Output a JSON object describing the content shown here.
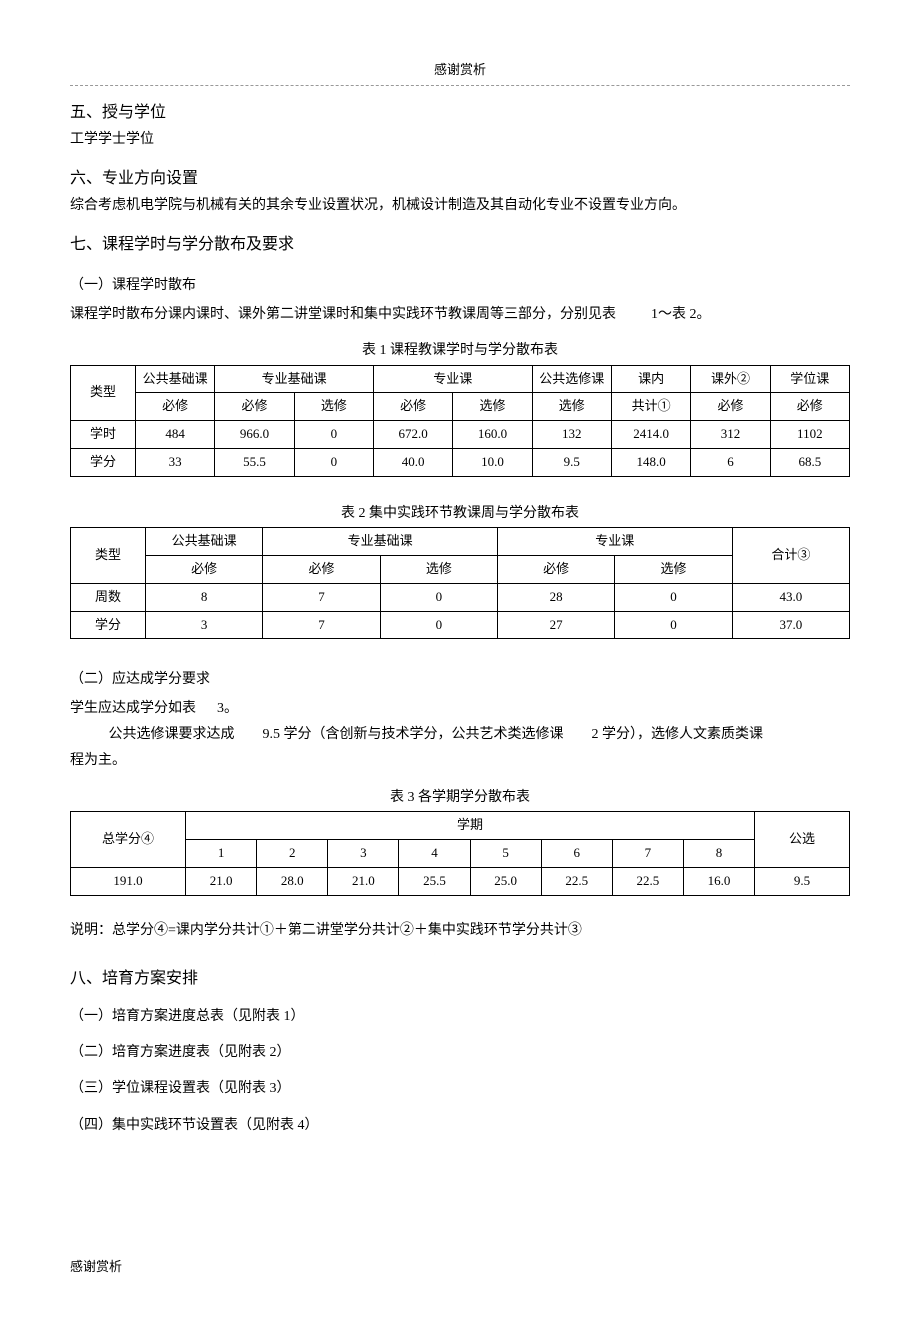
{
  "header": {
    "note_top": "感谢赏析",
    "note_bottom": "感谢赏析"
  },
  "s5": {
    "title": "五、授与学位",
    "body": "工学学士学位"
  },
  "s6": {
    "title": "六、专业方向设置",
    "body": "综合考虑机电学院与机械有关的其余专业设置状况，机械设计制造及其自动化专业不设置专业方向。"
  },
  "s7": {
    "title": "七、课程学时与学分散布及要求",
    "p1": {
      "heading": "（一）课程学时散布",
      "line_a": "课程学时散布分课内课时、课外第二讲堂课时和集中实践环节教课周等三部分，分别见表",
      "line_b": "1～表 2。"
    },
    "t1": {
      "caption": "表 1 课程教课学时与学分散布表",
      "type_label": "类型",
      "h1": [
        "公共基础课",
        "专业基础课",
        "专业课",
        "公共选修课",
        "课内",
        "课外②",
        "学位课"
      ],
      "h2": [
        "必修",
        "必修",
        "选修",
        "必修",
        "选修",
        "选修",
        "共计①",
        "必修",
        "必修"
      ],
      "rows": [
        {
          "label": "学时",
          "cells": [
            "484",
            "966.0",
            "0",
            "672.0",
            "160.0",
            "132",
            "2414.0",
            "312",
            "1102"
          ]
        },
        {
          "label": "学分",
          "cells": [
            "33",
            "55.5",
            "0",
            "40.0",
            "10.0",
            "9.5",
            "148.0",
            "6",
            "68.5"
          ]
        }
      ]
    },
    "t2": {
      "caption": "表 2 集中实践环节教课周与学分散布表",
      "type_label": "类型",
      "h1": [
        "公共基础课",
        "专业基础课",
        "专业课",
        "合计③"
      ],
      "h2": [
        "必修",
        "必修",
        "选修",
        "必修",
        "选修"
      ],
      "rows": [
        {
          "label": "周数",
          "cells": [
            "8",
            "7",
            "0",
            "28",
            "0",
            "43.0"
          ]
        },
        {
          "label": "学分",
          "cells": [
            "3",
            "7",
            "0",
            "27",
            "0",
            "37.0"
          ]
        }
      ]
    },
    "p2": {
      "heading": "（二）应达成学分要求",
      "l1a": "学生应达成学分如表",
      "l1b": "3。",
      "l2a": "公共选修课要求达成",
      "l2b": "9.5",
      "l2c": "学分（含创新与技术学分，公共艺术类选修课",
      "l2d": "2 学分），选修人文素质类课",
      "l3": "程为主。"
    },
    "t3": {
      "caption": "表 3   各学期学分散布表",
      "total_label": "总学分④",
      "sem_label": "学期",
      "pubsel_label": "公选",
      "sem_nums": [
        "1",
        "2",
        "3",
        "4",
        "5",
        "6",
        "7",
        "8"
      ],
      "row": [
        "191.0",
        "21.0",
        "28.0",
        "21.0",
        "25.5",
        "25.0",
        "22.5",
        "22.5",
        "16.0",
        "9.5"
      ]
    },
    "note": "说明：总学分④=课内学分共计①＋第二讲堂学分共计②＋集中实践环节学分共计③"
  },
  "s8": {
    "title": "八、培育方案安排",
    "items": [
      "（一）培育方案进度总表（见附表 1）",
      "（二）培育方案进度表（见附表 2）",
      "（三）学位课程设置表（见附表 3）",
      "（四）集中实践环节设置表（见附表 4）"
    ]
  }
}
